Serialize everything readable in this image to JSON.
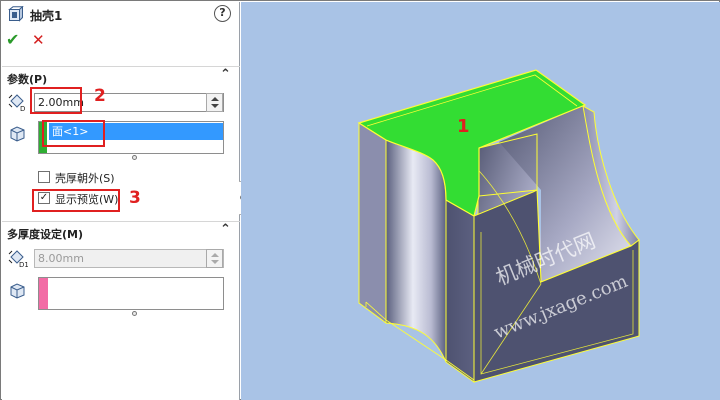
{
  "feature": {
    "title": "抽壳1",
    "help": "?",
    "ok_symbol": "✔",
    "cancel_symbol": "✕"
  },
  "parameters": {
    "header": "参数(P)",
    "thickness_value": "2.00mm",
    "faces_to_remove": [
      "面<1>"
    ],
    "shell_outward_label": "壳厚朝外(S)",
    "shell_outward_checked": false,
    "show_preview_label": "显示预览(W)",
    "show_preview_checked": true
  },
  "multi_thickness": {
    "header": "多厚度设定(M)",
    "thickness_value": "8.00mm",
    "faces": []
  },
  "annotations": {
    "callout_1": "1",
    "callout_2": "2",
    "callout_3": "3"
  },
  "colors": {
    "face_highlight": "#2fae33",
    "multi_face_marker": "#f26ca5",
    "selection": "#3399ff",
    "callout": "#e02020",
    "viewport_bg": "#a9c3e6",
    "preview_face": "#33dd33",
    "edge_highlight": "#ffff33"
  },
  "watermark": {
    "line1": "机械时代网",
    "line2": "www.jxage.com"
  }
}
